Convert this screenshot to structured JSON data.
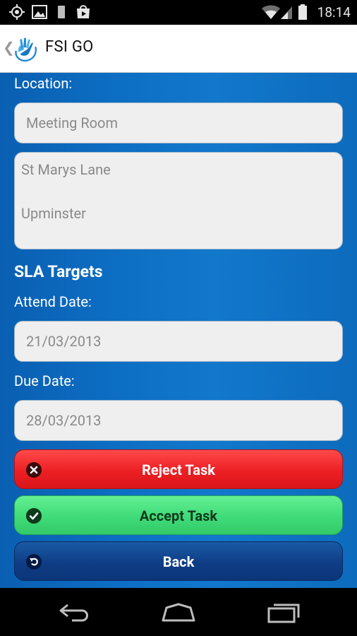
{
  "status_bar": {
    "time": "18:14",
    "icons": [
      "gps-icon",
      "image-icon",
      "phone-icon",
      "play-store-icon",
      "wifi-icon",
      "signal-icon",
      "battery-icon"
    ]
  },
  "action_bar": {
    "title": "FSI GO",
    "up_caret": "❮",
    "logo": "fsi-hand-logo"
  },
  "form": {
    "location_label": "Location:",
    "location_name": "Meeting Room",
    "address_line1": "St Marys Lane",
    "address_line2": "Upminster",
    "sla_heading": "SLA Targets",
    "attend_date_label": "Attend Date:",
    "attend_date": "21/03/2013",
    "due_date_label": "Due Date:",
    "due_date": "28/03/2013"
  },
  "buttons": {
    "reject_label": "Reject Task",
    "accept_label": "Accept Task",
    "back_label": "Back"
  },
  "colors": {
    "content_bg": "#0d6fc4",
    "reject": "#ec1f24",
    "accept": "#3fdb78",
    "back": "#0f3d86"
  },
  "nav_bar": {
    "icons": [
      "back-nav-icon",
      "home-nav-icon",
      "recents-nav-icon"
    ]
  }
}
